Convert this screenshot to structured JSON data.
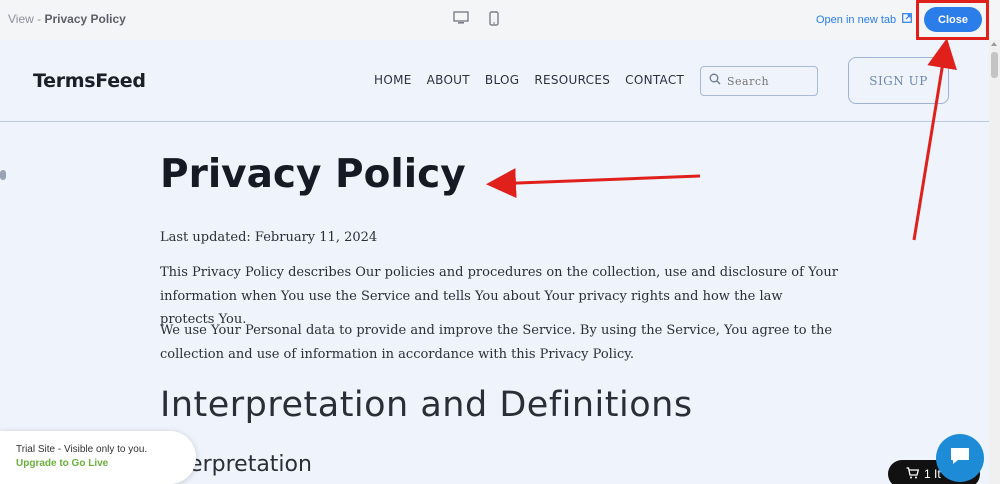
{
  "topbar": {
    "view_prefix": "View - ",
    "view_title": "Privacy Policy",
    "open_new_tab": "Open in new tab",
    "close_label": "Close"
  },
  "site": {
    "logo": "TermsFeed",
    "nav": [
      "HOME",
      "ABOUT",
      "BLOG",
      "RESOURCES",
      "CONTACT"
    ],
    "search_placeholder": "Search",
    "signup_label": "SIGN UP"
  },
  "page": {
    "title": "Privacy Policy",
    "last_updated": "Last updated: February 11, 2024",
    "para1": "This Privacy Policy describes Our policies and procedures on the collection, use and disclosure of Your information when You use the Service and tells You about Your privacy rights and how the law protects You.",
    "para2": "We use Your Personal data to provide and improve the Service. By using the Service, You agree to the collection and use of information in accordance with this Privacy Policy.",
    "h2": "Interpretation and Definitions",
    "h3": "Interpretation"
  },
  "trial": {
    "line1": "Trial Site - Visible only to you.",
    "line2": "Upgrade to Go Live"
  },
  "cart": {
    "label": "1 It"
  },
  "colors": {
    "accent": "#2b7de9",
    "annotation": "#e0201b",
    "page_bg": "#eef3fc"
  }
}
